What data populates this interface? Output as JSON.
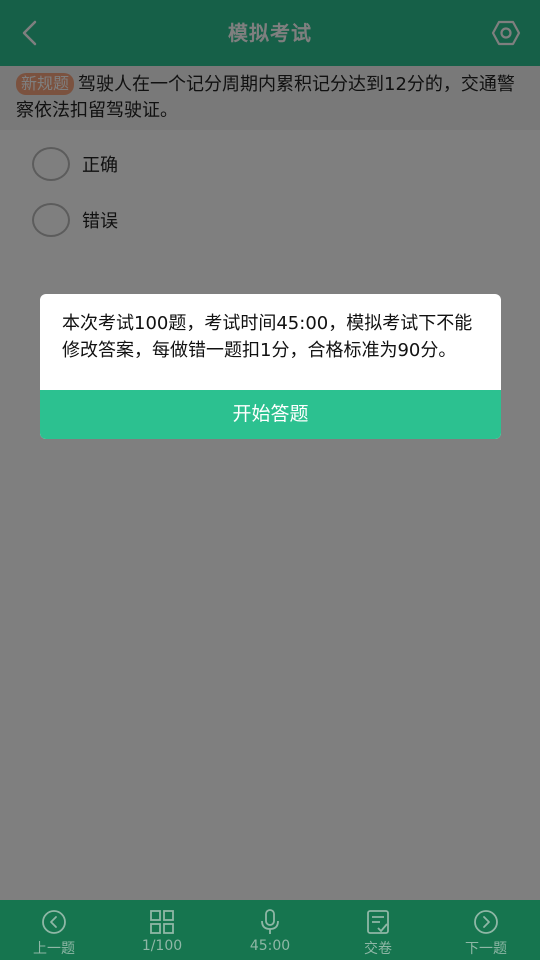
{
  "header": {
    "title": "模拟考试",
    "back_icon": "chevron-left-icon",
    "settings_icon": "hexagon-settings-icon"
  },
  "question": {
    "tag": "新规题",
    "text": "驾驶人在一个记分周期内累积记分达到12分的，交通警察依法扣留驾驶证。"
  },
  "options": [
    {
      "label": "正确"
    },
    {
      "label": "错误"
    }
  ],
  "dialog": {
    "message": "本次考试100题，考试时间45:00，模拟考试下不能修改答案，每做错一题扣1分，合格标准为90分。",
    "button_label": "开始答题"
  },
  "bottom_bar": {
    "items": [
      {
        "label": "上一题",
        "icon": "circle-chevron-left-icon"
      },
      {
        "label": "1/100",
        "icon": "grid-icon"
      },
      {
        "label": "45:00",
        "icon": "microphone-icon"
      },
      {
        "label": "交卷",
        "icon": "submit-paper-icon"
      },
      {
        "label": "下一题",
        "icon": "circle-chevron-right-icon"
      }
    ]
  },
  "colors": {
    "primary": "#2cc190",
    "tag": "#f6a47f",
    "bottom_bar": "#16754f"
  }
}
